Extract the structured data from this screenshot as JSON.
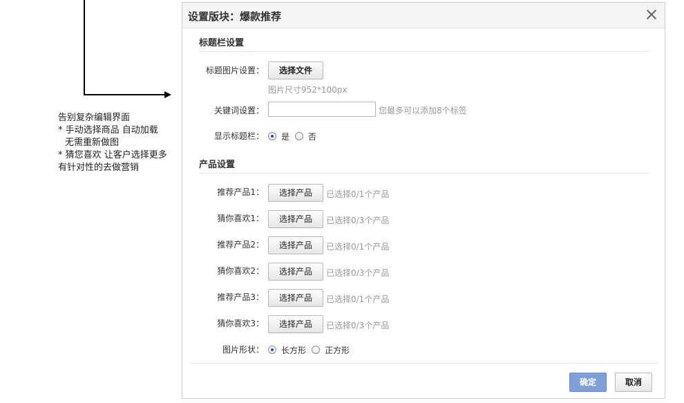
{
  "annotation": {
    "lines": [
      "告别复杂编辑界面",
      "* 手动选择商品 自动加载",
      "无需重新做图",
      "* 猜您喜欢 让客户选择更多",
      "有针对性的去做营销"
    ]
  },
  "dialog": {
    "title": "设置版块：爆款推荐",
    "close_icon": "close-icon",
    "title_section": {
      "heading": "标题栏设置",
      "image_label": "标题图片设置：",
      "choose_file_label": "选择文件",
      "image_size_hint": "图片尺寸952*100px",
      "keyword_label": "关键词设置：",
      "keyword_value": "",
      "keyword_hint": "您最多可以添加8个标签",
      "show_title_label": "显示标题栏：",
      "show_title_options": [
        "是",
        "否"
      ],
      "show_title_selected": "是"
    },
    "product_section": {
      "heading": "产品设置",
      "choose_product_label": "选择产品",
      "rows": [
        {
          "label": "推荐产品1：",
          "status": "已选择0/1个产品"
        },
        {
          "label": "猜你喜欢1：",
          "status": "已选择0/3个产品"
        },
        {
          "label": "推荐产品2：",
          "status": "已选择0/1个产品"
        },
        {
          "label": "猜你喜欢2：",
          "status": "已选择0/3个产品"
        },
        {
          "label": "推荐产品3：",
          "status": "已选择0/1个产品"
        },
        {
          "label": "猜你喜欢3：",
          "status": "已选择0/3个产品"
        }
      ],
      "shape_label": "图片形状：",
      "shape_options": [
        "长方形",
        "正方形"
      ],
      "shape_selected": "长方形"
    },
    "footer": {
      "ok_label": "确定",
      "cancel_label": "取消"
    }
  },
  "colors": {
    "ok_button": "#7f9fd8",
    "hint_text": "#999999",
    "header_bg": "#f4f4f4"
  }
}
